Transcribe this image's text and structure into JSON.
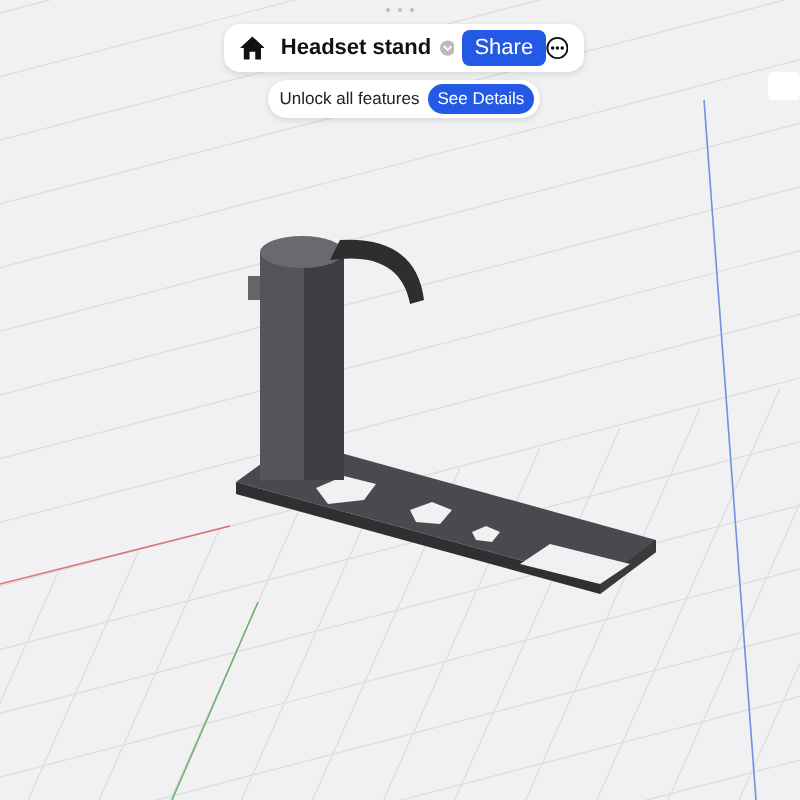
{
  "toolbar": {
    "title": "Headset stand",
    "share_button": "Share"
  },
  "banner": {
    "text": "Unlock all features",
    "button": "See Details"
  }
}
